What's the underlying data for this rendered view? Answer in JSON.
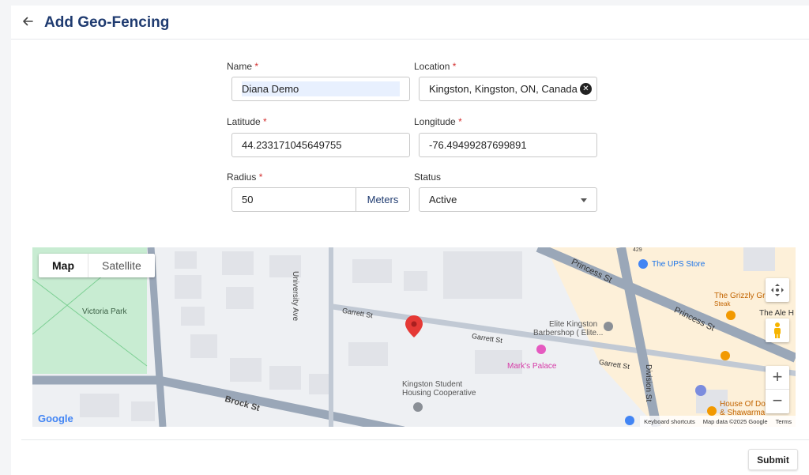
{
  "header": {
    "title": "Add Geo-Fencing"
  },
  "form": {
    "name": {
      "label": "Name",
      "required": "*",
      "value": "Diana Demo"
    },
    "location": {
      "label": "Location",
      "required": "*",
      "value": "Kingston, Kingston, ON, Canada"
    },
    "latitude": {
      "label": "Latitude",
      "required": "*",
      "value": "44.233171045649755"
    },
    "longitude": {
      "label": "Longitude",
      "required": "*",
      "value": "-76.49499287699891"
    },
    "radius": {
      "label": "Radius",
      "required": "*",
      "value": "50",
      "unit_label": "Meters"
    },
    "status": {
      "label": "Status",
      "value": "Active"
    }
  },
  "map": {
    "type_buttons": {
      "map": "Map",
      "satellite": "Satellite"
    },
    "places": {
      "victoria_park": "Victoria Park",
      "university_ave": "University Ave",
      "garrett_st_1": "Garrett St",
      "garrett_st_2": "Garrett St",
      "garrett_st_3": "Garrett St",
      "brock_st": "Brock St",
      "princess_st_1": "Princess St",
      "princess_st_2": "Princess St",
      "division_st": "Division St",
      "ups_store": "The UPS Store",
      "grizzly": "The Grizzly Gri",
      "grizzly_sub": "Steak",
      "ale_house": "The Ale H",
      "elite_kingston": "Elite Kingston",
      "elite_kingston_2": "Barbershop ( Elite...",
      "marks_palace": "Mark's Palace",
      "kingston_housing": "Kingston Student",
      "kingston_housing_2": "Housing Cooperative",
      "house_of_doner": "House Of Do",
      "house_of_doner_2": "& Shawarma",
      "road_num": "429"
    },
    "zoom_in": "+",
    "zoom_out": "−",
    "google_logo": "Google",
    "attribution": {
      "shortcuts": "Keyboard shortcuts",
      "data": "Map data ©2025 Google",
      "terms": "Terms"
    }
  },
  "footer": {
    "submit_label": "Submit"
  }
}
